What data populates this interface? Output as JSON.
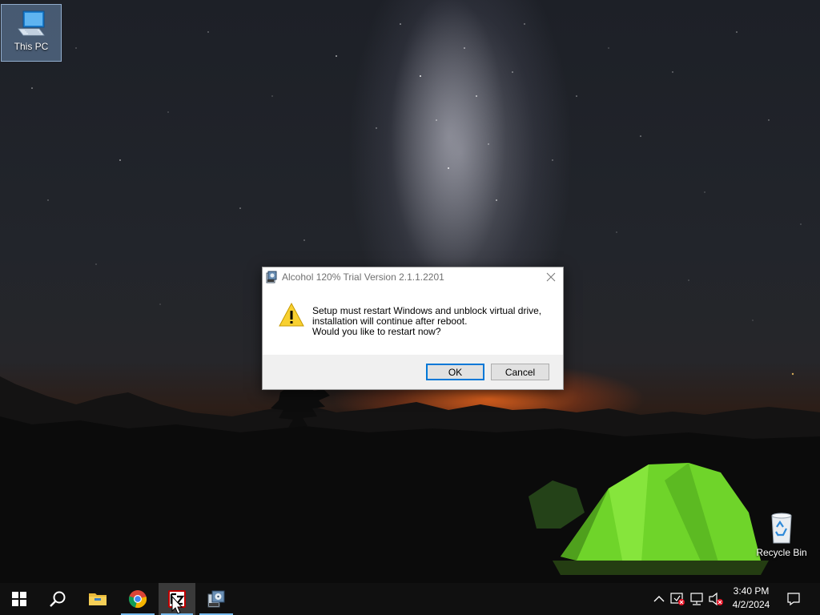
{
  "desktop": {
    "icons": [
      {
        "label": "This PC",
        "icon": "this-pc-icon"
      },
      {
        "label": "Recycle Bin",
        "icon": "recycle-bin-icon"
      }
    ]
  },
  "dialog": {
    "title": "Alcohol 120% Trial Version 2.1.1.2201",
    "icon": "installer-icon",
    "message_lines": [
      "Setup must restart Windows and unblock virtual drive,",
      "installation will continue after reboot.",
      "Would you like to restart now?"
    ],
    "ok_label": "OK",
    "cancel_label": "Cancel",
    "warning_icon": "warning-icon"
  },
  "taskbar": {
    "apps": [
      {
        "name": "start",
        "icon": "windows-start-icon"
      },
      {
        "name": "search",
        "icon": "search-icon"
      },
      {
        "name": "file-explorer",
        "icon": "folder-icon"
      },
      {
        "name": "chrome",
        "icon": "chrome-icon"
      },
      {
        "name": "filezilla",
        "icon": "filezilla-icon"
      },
      {
        "name": "alcohol-setup",
        "icon": "installer-icon"
      }
    ],
    "tray": {
      "icons": [
        "chevron-up-icon",
        "security-alert-icon",
        "network-icon",
        "volume-muted-icon"
      ],
      "time": "3:40 PM",
      "date": "4/2/2024",
      "notification_icon": "notification-icon"
    },
    "accent": "#76b9ed"
  },
  "colors": {
    "ok_border": "#0078d7",
    "tent": "#6fd42a",
    "horizon_glow": "#ff6e1e"
  }
}
